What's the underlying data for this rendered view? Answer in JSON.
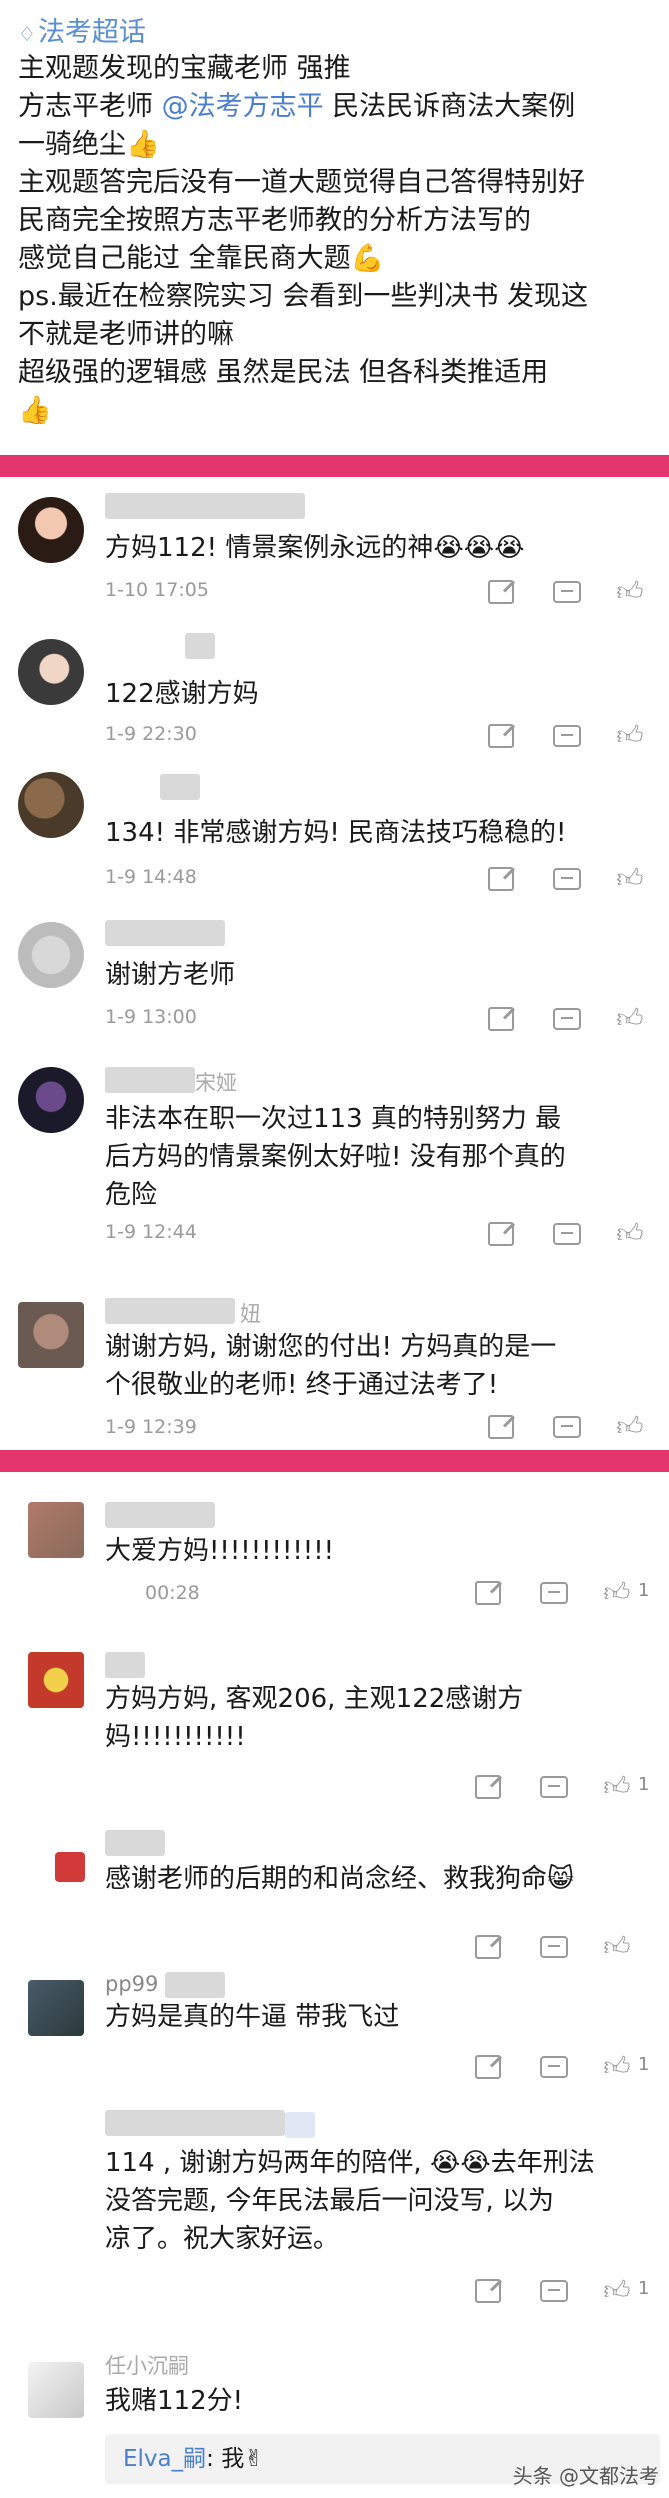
{
  "post": {
    "tag": "法考超话",
    "lines": [
      "主观题发现的宝藏老师 强推",
      "方志平老师",
      "一骑绝尘👍",
      "主观题答完后没有一道大题觉得自己答得特别好",
      "民商完全按照方志平老师教的分析方法写的",
      "感觉自己能过 全靠民商大题💪",
      "ps.最近在检察院实习 会看到一些判决书 发现这",
      "不就是老师讲的嘛",
      "超级强的逻辑感   虽然是民法 但各科类推适用",
      "👍"
    ],
    "mention": "@法考方志平",
    "line2_tail": "民法民诉商法大案例"
  },
  "comments_a": [
    {
      "text": "方妈112! 情景案例永远的神😭😭😭",
      "meta": "1-10 17:05"
    },
    {
      "text": "122感谢方妈",
      "meta": "1-9 22:30"
    },
    {
      "text": "134! 非常感谢方妈! 民商法技巧稳稳的!",
      "meta": "1-9 14:48"
    },
    {
      "text": "谢谢方老师",
      "meta": "1-9 13:00"
    },
    {
      "text1": "非法本在职一次过113  真的特别努力  最",
      "text2": "后方妈的情景案例太好啦! 没有那个真的",
      "text3": "危险",
      "meta": "1-9 12:44",
      "name": "宋娅"
    },
    {
      "text1": "谢谢方妈, 谢谢您的付出! 方妈真的是一",
      "text2": "个很敬业的老师! 终于通过法考了!",
      "meta": "1-9 12:39",
      "name": "妞"
    }
  ],
  "comments_b": [
    {
      "text": "大爱方妈!!!!!!!!!!!!",
      "meta": "00:28",
      "likes": "1"
    },
    {
      "text1": "方妈方妈, 客观206, 主观122感谢方",
      "text2": "妈!!!!!!!!!!!",
      "likes": "1"
    },
    {
      "text": "感谢老师的后期的和尚念经、救我狗命😸"
    },
    {
      "text": "方妈是真的牛逼 带我飞过",
      "name": "pp99",
      "likes": "1"
    },
    {
      "text1": "114 , 谢谢方妈两年的陪伴, 😭😭去年刑法",
      "text2": "没答完题, 今年民法最后一问没写, 以为",
      "text3": "凉了。祝大家好运。",
      "likes": "1"
    },
    {
      "text": "我赌112分!",
      "name": "任小沉嗣",
      "reply_name": "Elva_嗣",
      "reply_text": ": 我✌"
    }
  ],
  "watermark": "头条 @文都法考",
  "colors": {
    "divider": "#e5356f",
    "mention": "#4a7fd0",
    "meta": "#9a9a9a"
  },
  "icons": [
    "diamond-icon",
    "edit-icon",
    "comment-icon",
    "like-icon"
  ]
}
